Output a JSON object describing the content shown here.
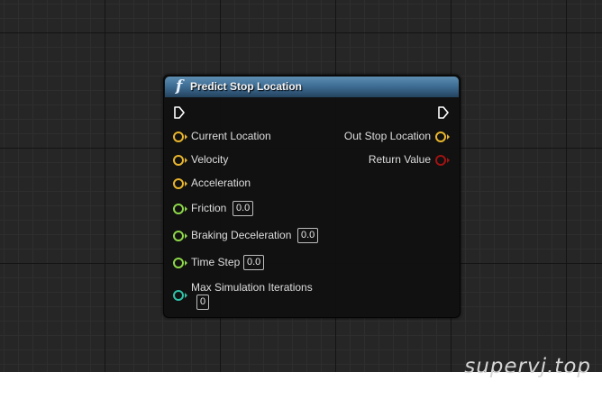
{
  "node": {
    "title": "Predict Stop Location",
    "function_icon": "f",
    "inputs": [
      {
        "name": "Current Location",
        "type": "vector",
        "color": "#e8b52d"
      },
      {
        "name": "Velocity",
        "type": "vector",
        "color": "#e8b52d"
      },
      {
        "name": "Acceleration",
        "type": "vector",
        "color": "#e8b52d"
      },
      {
        "name": "Friction",
        "type": "float",
        "color": "#8ed74a",
        "value": "0.0"
      },
      {
        "name": "Braking Deceleration",
        "type": "float",
        "color": "#8ed74a",
        "value": "0.0"
      },
      {
        "name": "Time Step",
        "type": "float",
        "color": "#8ed74a",
        "value": "0.0"
      },
      {
        "name": "Max Simulation Iterations",
        "type": "int",
        "color": "#2ec2a8",
        "value": "0"
      }
    ],
    "outputs": [
      {
        "name": "Out Stop Location",
        "type": "vector",
        "color": "#e8b52d"
      },
      {
        "name": "Return Value",
        "type": "bool",
        "color": "#a11313"
      }
    ]
  },
  "watermark": "supervj.top"
}
